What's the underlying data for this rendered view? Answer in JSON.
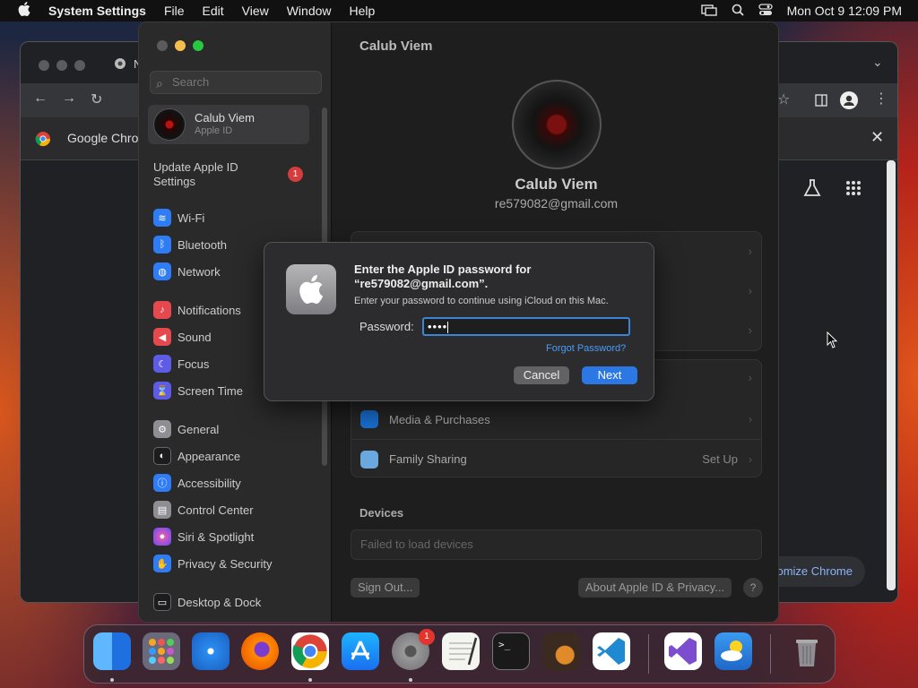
{
  "menubar": {
    "app_name": "System Settings",
    "menus": [
      "File",
      "Edit",
      "View",
      "Window",
      "Help"
    ],
    "clock": "Mon Oct 9  12:09 PM"
  },
  "chrome": {
    "tab_title": "N",
    "infobar_text": "Google Chro",
    "customize_label": "omize Chrome"
  },
  "settings": {
    "search_placeholder": "Search",
    "account": {
      "name": "Calub Viem",
      "subtitle": "Apple ID"
    },
    "update": {
      "label": "Update Apple ID Settings",
      "badge": "1"
    },
    "sidebar_items": [
      {
        "label": "Wi-Fi",
        "icon": "wifi-icon",
        "color": "#2e7cf6"
      },
      {
        "label": "Bluetooth",
        "icon": "bluetooth-icon",
        "color": "#2e7cf6"
      },
      {
        "label": "Network",
        "icon": "globe-icon",
        "color": "#2e7cf6"
      },
      {
        "label": "Notifications",
        "icon": "bell-icon",
        "color": "#e5484d"
      },
      {
        "label": "Sound",
        "icon": "speaker-icon",
        "color": "#e5484d"
      },
      {
        "label": "Focus",
        "icon": "moon-icon",
        "color": "#5e5ce6"
      },
      {
        "label": "Screen Time",
        "icon": "hourglass-icon",
        "color": "#5e5ce6"
      },
      {
        "label": "General",
        "icon": "gear-icon",
        "color": "#8e8e93"
      },
      {
        "label": "Appearance",
        "icon": "appearance-icon",
        "color": "#1c1c1e"
      },
      {
        "label": "Accessibility",
        "icon": "accessibility-icon",
        "color": "#2e7cf6"
      },
      {
        "label": "Control Center",
        "icon": "control-center-icon",
        "color": "#8e8e93"
      },
      {
        "label": "Siri & Spotlight",
        "icon": "siri-icon",
        "color": "#b84fd8"
      },
      {
        "label": "Privacy & Security",
        "icon": "hand-icon",
        "color": "#2e7cf6"
      },
      {
        "label": "Desktop & Dock",
        "icon": "desktop-icon",
        "color": "#1c1c1e"
      }
    ],
    "main": {
      "title": "Calub Viem",
      "profile_name": "Calub Viem",
      "profile_email": "re579082@gmail.com",
      "rows": [
        {
          "label": "Media & Purchases",
          "value": ""
        },
        {
          "label": "Family Sharing",
          "value": "Set Up"
        }
      ],
      "devices_heading": "Devices",
      "devices_status": "Failed to load devices",
      "sign_out_label": "Sign Out...",
      "about_label": "About Apple ID & Privacy...",
      "help_label": "?"
    }
  },
  "dialog": {
    "title": "Enter the Apple ID password for “re579082@gmail.com”.",
    "subtitle": "Enter your password to continue using iCloud on this Mac.",
    "password_label": "Password:",
    "password_mask": "••••",
    "forgot_label": "Forgot Password?",
    "cancel_label": "Cancel",
    "next_label": "Next"
  },
  "dock": {
    "badge": "1",
    "apps": [
      {
        "name": "finder",
        "color": "#1e90ff"
      },
      {
        "name": "launchpad",
        "color": "#6a6a7a"
      },
      {
        "name": "safari",
        "color": "#2a8cf0"
      },
      {
        "name": "firefox",
        "color": "#e66000"
      },
      {
        "name": "chrome",
        "color": "#ffffff"
      },
      {
        "name": "app-store",
        "color": "#1a8cff"
      },
      {
        "name": "system-settings",
        "color": "#8a8a8e"
      },
      {
        "name": "textedit",
        "color": "#f5f5f0"
      },
      {
        "name": "terminal",
        "color": "#1a1a1a"
      },
      {
        "name": "garageband",
        "color": "#3a2a20"
      },
      {
        "name": "vscode",
        "color": "#ffffff"
      },
      {
        "name": "visual-studio",
        "color": "#ffffff"
      },
      {
        "name": "weather",
        "color": "#2f7fd8"
      },
      {
        "name": "trash",
        "color": "#6e6e73"
      }
    ]
  }
}
